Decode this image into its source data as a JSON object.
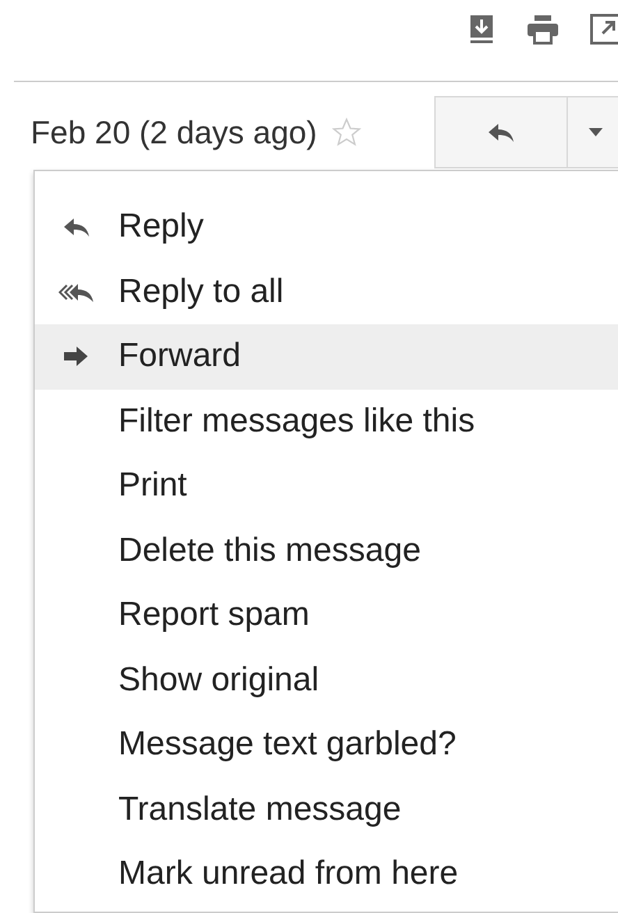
{
  "message_header": {
    "date": "Feb 20 (2 days ago)",
    "starred": false
  },
  "menu": {
    "items": [
      {
        "label": "Reply",
        "kind": "reply",
        "selected": false
      },
      {
        "label": "Reply to all",
        "kind": "reply-all",
        "selected": false
      },
      {
        "label": "Forward",
        "kind": "forward",
        "selected": true
      },
      {
        "label": "Filter messages like this",
        "kind": "plain",
        "selected": false
      },
      {
        "label": "Print",
        "kind": "plain",
        "selected": false
      },
      {
        "label": "Delete this message",
        "kind": "plain",
        "selected": false
      },
      {
        "label": "Report spam",
        "kind": "plain",
        "selected": false
      },
      {
        "label": "Show original",
        "kind": "plain",
        "selected": false
      },
      {
        "label": "Message text garbled?",
        "kind": "plain",
        "selected": false
      },
      {
        "label": "Translate message",
        "kind": "plain",
        "selected": false
      },
      {
        "label": "Mark unread from here",
        "kind": "plain",
        "selected": false
      }
    ]
  }
}
